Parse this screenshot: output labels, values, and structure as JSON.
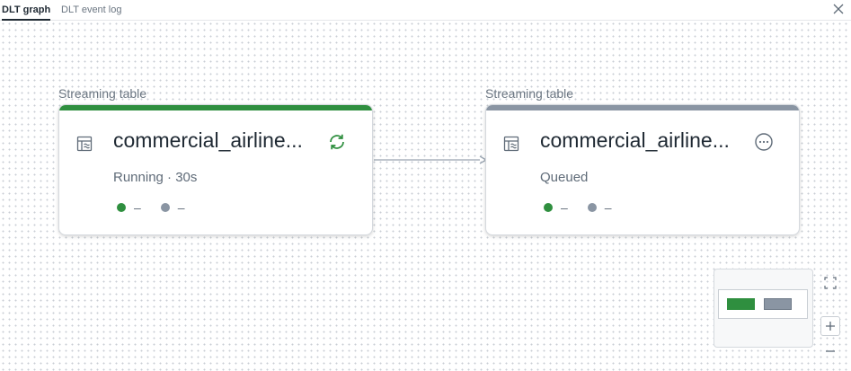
{
  "tabs": [
    {
      "label": "DLT graph",
      "active": true
    },
    {
      "label": "DLT event log",
      "active": false
    }
  ],
  "header": {
    "close_icon": "close-icon"
  },
  "nodes": [
    {
      "type_label": "Streaming table",
      "name": "commercial_airline...",
      "status": "Running · 30s",
      "state_icon": "refresh-running-icon",
      "accent_color": "#2f8f3f",
      "metrics": [
        {
          "value": "–",
          "color": "#2f8f3f"
        },
        {
          "value": "–",
          "color": "#8a95a3"
        }
      ]
    },
    {
      "type_label": "Streaming table",
      "name": "commercial_airline...",
      "status": "Queued",
      "state_icon": "more-horizontal-circle-icon",
      "accent_color": "#8a95a3",
      "metrics": [
        {
          "value": "–",
          "color": "#2f8f3f"
        },
        {
          "value": "–",
          "color": "#8a95a3"
        }
      ]
    }
  ],
  "controls": {
    "fit_icon": "fit-view-icon",
    "zoom_in_icon": "zoom-in-icon",
    "zoom_out_icon": "zoom-out-icon"
  },
  "colors": {
    "running": "#2f8f3f",
    "queued": "#8a95a3",
    "edge": "#9aa5b1"
  }
}
